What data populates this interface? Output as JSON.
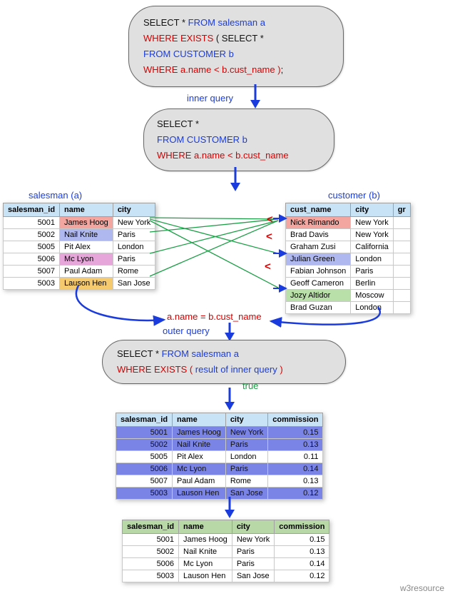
{
  "boxes": {
    "q1": {
      "l1a": "SELECT * ",
      "l1b": "FROM salesman a",
      "l2a": "WHERE EXISTS",
      "l2b": "  ( SELECT *",
      "l3": "FROM CUSTOMER b",
      "l4a": "WHERE  a.name  < b.cust_name )",
      "l4b": ";"
    },
    "q2": {
      "l1": "SELECT *",
      "l2": "FROM CUSTOMER b",
      "l3": "WHERE  a.name  < b.cust_name"
    },
    "q3": {
      "l1a": "SELECT * ",
      "l1b": "FROM salesman a",
      "l2a": "WHERE EXISTS ( ",
      "l2b": "result of inner query",
      "l2c": " )",
      "l3": "true"
    }
  },
  "labels": {
    "inner_query": "inner query",
    "outer_query": "outer query",
    "salesman_a": "salesman (a)",
    "customer_b": "customer (b)",
    "compare": "a.name = b.cust_name",
    "footer": "w3resource"
  },
  "cmp": {
    "s1": "<",
    "s2": "<",
    "s3": "<"
  },
  "salesman": {
    "headers": {
      "id": "salesman_id",
      "name": "name",
      "city": "city"
    },
    "rows": [
      {
        "id": "5001",
        "name": "James Hoog",
        "city": "New York"
      },
      {
        "id": "5002",
        "name": "Nail Knite",
        "city": "Paris"
      },
      {
        "id": "5005",
        "name": "Pit Alex",
        "city": "London"
      },
      {
        "id": "5006",
        "name": "Mc Lyon",
        "city": "Paris"
      },
      {
        "id": "5007",
        "name": "Paul Adam",
        "city": "Rome"
      },
      {
        "id": "5003",
        "name": "Lauson Hen",
        "city": "San Jose"
      }
    ]
  },
  "customer": {
    "headers": {
      "name": "cust_name",
      "city": "city",
      "gr": "gr"
    },
    "rows": [
      {
        "name": "Nick Rimando",
        "city": "New York"
      },
      {
        "name": "Brad Davis",
        "city": "New York"
      },
      {
        "name": "Graham Zusi",
        "city": "California"
      },
      {
        "name": "Julian Green",
        "city": "London"
      },
      {
        "name": "Fabian Johnson",
        "city": "Paris"
      },
      {
        "name": "Geoff Cameron",
        "city": "Berlin"
      },
      {
        "name": "Jozy Altidor",
        "city": "Moscow"
      },
      {
        "name": "Brad Guzan",
        "city": "London"
      }
    ]
  },
  "result1": {
    "headers": {
      "id": "salesman_id",
      "name": "name",
      "city": "city",
      "comm": "commission"
    },
    "rows": [
      {
        "id": "5001",
        "name": "James Hoog",
        "city": "New York",
        "comm": "0.15",
        "hl": true
      },
      {
        "id": "5002",
        "name": "Nail Knite",
        "city": "Paris",
        "comm": "0.13",
        "hl": true
      },
      {
        "id": "5005",
        "name": "Pit Alex",
        "city": "London",
        "comm": "0.11",
        "hl": false
      },
      {
        "id": "5006",
        "name": "Mc Lyon",
        "city": "Paris",
        "comm": "0.14",
        "hl": true
      },
      {
        "id": "5007",
        "name": "Paul Adam",
        "city": "Rome",
        "comm": "0.13",
        "hl": false
      },
      {
        "id": "5003",
        "name": "Lauson Hen",
        "city": "San Jose",
        "comm": "0.12",
        "hl": true
      }
    ]
  },
  "result2": {
    "headers": {
      "id": "salesman_id",
      "name": "name",
      "city": "city",
      "comm": "commission"
    },
    "rows": [
      {
        "id": "5001",
        "name": "James Hoog",
        "city": "New York",
        "comm": "0.15"
      },
      {
        "id": "5002",
        "name": "Nail Knite",
        "city": "Paris",
        "comm": "0.13"
      },
      {
        "id": "5006",
        "name": "Mc Lyon",
        "city": "Paris",
        "comm": "0.14"
      },
      {
        "id": "5003",
        "name": "Lauson Hen",
        "city": "San Jose",
        "comm": "0.12"
      }
    ]
  }
}
